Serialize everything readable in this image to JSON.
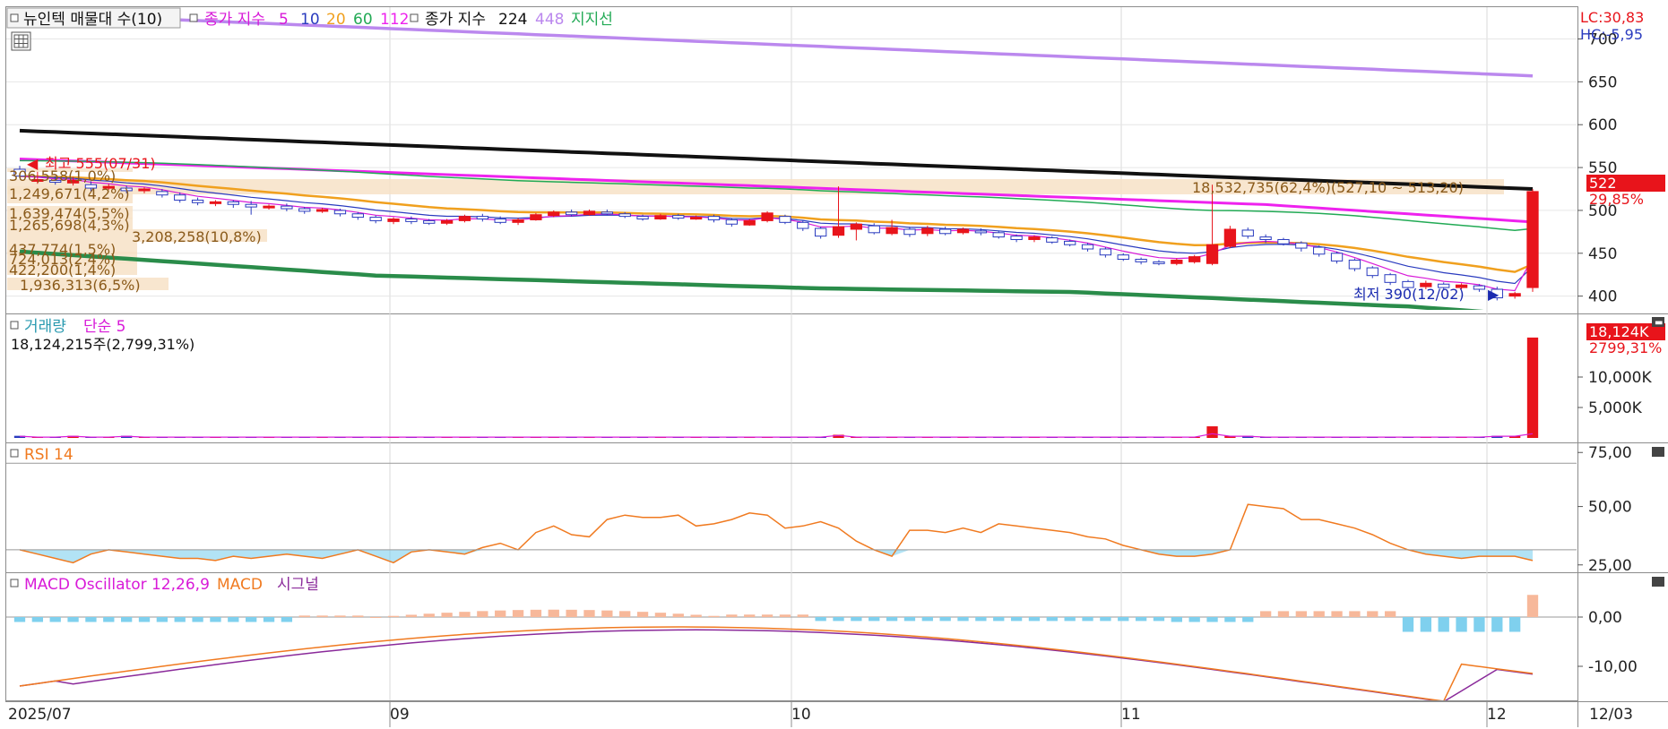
{
  "header": {
    "stock_label": "뉴인텍 매물대 수(10)",
    "ma_prefix": "종가 지수",
    "ma_periods": [
      "5",
      "10",
      "20",
      "60",
      "112"
    ],
    "ma_prefix2": "종가 지수",
    "ma_periods2": [
      "224",
      "448"
    ],
    "support_label": "지지선",
    "lc_label": "LC:30,83",
    "hc_label": "HC:-5,95"
  },
  "price_panel": {
    "current_price": "522",
    "current_change": "29,85%",
    "high_label": "최고 555(07/31)",
    "low_label": "최저 390(12/02)",
    "volume_profile": [
      {
        "label": "306,558(1,0%)"
      },
      {
        "label": "1,249,671(4,2%)"
      },
      {
        "label": "1,639,474(5,5%)"
      },
      {
        "label": "1,265,698(4,3%)"
      },
      {
        "label": "3,208,258(10,8%)"
      },
      {
        "label": "437,774(1,5%)"
      },
      {
        "label": "724,013(2,4%)"
      },
      {
        "label": "422,200(1,4%)"
      },
      {
        "label": "1,936,313(6,5%)"
      },
      {
        "label": "18,532,735(62,4%)(527,10 ~ 513,20)"
      }
    ]
  },
  "volume_panel": {
    "title": "거래량",
    "ma_label": "단순 5",
    "value_label": "18,124,215주(2,799,31%)",
    "current_value": "18,124K",
    "current_change": "2799,31%"
  },
  "rsi_panel": {
    "title": "RSI 14"
  },
  "macd_panel": {
    "title": "MACD Oscillator 12,26,9",
    "macd_label": "MACD",
    "signal_label": "시그널"
  },
  "x_axis": {
    "labels": [
      "2025/07",
      "09",
      "10",
      "11",
      "12"
    ],
    "right_label": "12/03"
  },
  "colors": {
    "up": "#e8141b",
    "down": "#2a3bbf",
    "ma5": "#d81ad8",
    "ma10": "#2a3bbf",
    "ma20": "#f0a01e",
    "ma60": "#22aa55",
    "ma112": "#ee22ee",
    "ma224": "#111111",
    "ma448": "#bb88ee",
    "support": "#2a8c4a",
    "rsi": "#f07a20",
    "macd": "#f07a20",
    "signal": "#8a2a9a",
    "osc_up": "#f7b89a",
    "osc_down": "#7fd0ee"
  },
  "chart_data": [
    {
      "type": "candlestick",
      "ylim": [
        385,
        735
      ],
      "ticks": [
        400,
        450,
        500,
        550,
        600,
        650,
        700
      ],
      "ohlc": [
        [
          548,
          540,
          552,
          538
        ],
        [
          534,
          536,
          545,
          531
        ],
        [
          535,
          533,
          540,
          530
        ],
        [
          532,
          535,
          539,
          529
        ],
        [
          530,
          526,
          534,
          522
        ],
        [
          527,
          528,
          531,
          524
        ],
        [
          526,
          523,
          529,
          520
        ],
        [
          523,
          525,
          527,
          520
        ],
        [
          522,
          518,
          525,
          515
        ],
        [
          518,
          512,
          521,
          509
        ],
        [
          512,
          509,
          515,
          506
        ],
        [
          509,
          510,
          512,
          505
        ],
        [
          510,
          507,
          512,
          503
        ],
        [
          507,
          504,
          511,
          495
        ],
        [
          504,
          505,
          507,
          501
        ],
        [
          505,
          502,
          508,
          499
        ],
        [
          502,
          499,
          504,
          496
        ],
        [
          499,
          501,
          503,
          497
        ],
        [
          500,
          496,
          502,
          493
        ],
        [
          496,
          492,
          498,
          489
        ],
        [
          492,
          488,
          494,
          485
        ],
        [
          487,
          490,
          492,
          484
        ],
        [
          490,
          487,
          493,
          484
        ],
        [
          488,
          485,
          490,
          483
        ],
        [
          485,
          488,
          490,
          483
        ],
        [
          488,
          493,
          495,
          486
        ],
        [
          493,
          490,
          496,
          487
        ],
        [
          490,
          486,
          493,
          484
        ],
        [
          486,
          489,
          491,
          483
        ],
        [
          489,
          495,
          497,
          488
        ],
        [
          494,
          498,
          500,
          492
        ],
        [
          498,
          495,
          501,
          493
        ],
        [
          495,
          499,
          501,
          494
        ],
        [
          498,
          496,
          501,
          494
        ],
        [
          496,
          493,
          498,
          491
        ],
        [
          493,
          490,
          495,
          488
        ],
        [
          490,
          494,
          496,
          489
        ],
        [
          494,
          491,
          496,
          489
        ],
        [
          491,
          492,
          494,
          489
        ],
        [
          493,
          489,
          495,
          486
        ],
        [
          489,
          484,
          491,
          481
        ],
        [
          483,
          488,
          490,
          482
        ],
        [
          488,
          497,
          499,
          486
        ],
        [
          493,
          486,
          495,
          484
        ],
        [
          486,
          479,
          488,
          476
        ],
        [
          479,
          470,
          481,
          467
        ],
        [
          471,
          481,
          528,
          468
        ],
        [
          478,
          484,
          486,
          465
        ],
        [
          482,
          474,
          485,
          472
        ],
        [
          473,
          480,
          489,
          471
        ],
        [
          478,
          472,
          481,
          469
        ],
        [
          473,
          479,
          482,
          470
        ],
        [
          478,
          473,
          481,
          471
        ],
        [
          474,
          478,
          480,
          472
        ],
        [
          476,
          474,
          479,
          471
        ],
        [
          474,
          469,
          476,
          467
        ],
        [
          470,
          466,
          472,
          463
        ],
        [
          466,
          469,
          471,
          463
        ],
        [
          468,
          463,
          470,
          461
        ],
        [
          464,
          460,
          466,
          458
        ],
        [
          460,
          455,
          462,
          452
        ],
        [
          455,
          448,
          457,
          445
        ],
        [
          448,
          443,
          450,
          441
        ],
        [
          443,
          440,
          445,
          437
        ],
        [
          440,
          438,
          442,
          436
        ],
        [
          438,
          442,
          444,
          436
        ],
        [
          440,
          446,
          448,
          438
        ],
        [
          438,
          460,
          530,
          436
        ],
        [
          458,
          478,
          482,
          456
        ],
        [
          477,
          470,
          480,
          467
        ],
        [
          469,
          466,
          472,
          462
        ],
        [
          466,
          461,
          468,
          459
        ],
        [
          462,
          456,
          464,
          452
        ],
        [
          457,
          449,
          459,
          446
        ],
        [
          450,
          441,
          452,
          438
        ],
        [
          442,
          432,
          444,
          429
        ],
        [
          433,
          424,
          435,
          421
        ],
        [
          425,
          416,
          427,
          413
        ],
        [
          417,
          410,
          419,
          407
        ],
        [
          411,
          415,
          418,
          408
        ],
        [
          414,
          410,
          416,
          407
        ],
        [
          410,
          413,
          415,
          408
        ],
        [
          412,
          408,
          414,
          405
        ],
        [
          408,
          398,
          411,
          395
        ],
        [
          400,
          403,
          405,
          397
        ],
        [
          410,
          522,
          525,
          405
        ]
      ]
    },
    {
      "type": "bar",
      "series": [
        {
          "name": "거래량",
          "values": [
            2,
            1,
            1,
            2,
            1,
            1,
            2,
            1,
            1,
            1,
            1,
            1,
            1,
            1,
            1,
            1,
            1,
            1,
            1,
            1,
            1,
            1,
            1,
            1,
            1,
            1,
            1,
            1,
            1,
            1,
            1,
            1,
            1,
            1,
            1,
            1,
            1,
            1,
            1,
            1,
            1,
            1,
            1,
            1,
            1,
            1,
            3,
            1,
            1,
            1,
            1,
            1,
            1,
            1,
            1,
            1,
            1,
            1,
            1,
            1,
            1,
            1,
            1,
            1,
            1,
            1,
            1,
            11,
            2,
            2,
            1,
            1,
            1,
            1,
            1,
            1,
            1,
            1,
            1,
            1,
            1,
            1,
            1,
            2,
            2,
            95
          ]
        }
      ]
    },
    {
      "type": "line",
      "series": [
        {
          "name": "RSI 14"
        }
      ],
      "ticks": [
        25,
        50,
        75
      ]
    },
    {
      "type": "line",
      "series": [
        {
          "name": "MACD"
        },
        {
          "name": "시그널"
        }
      ],
      "ticks": [
        0,
        -10
      ]
    }
  ]
}
